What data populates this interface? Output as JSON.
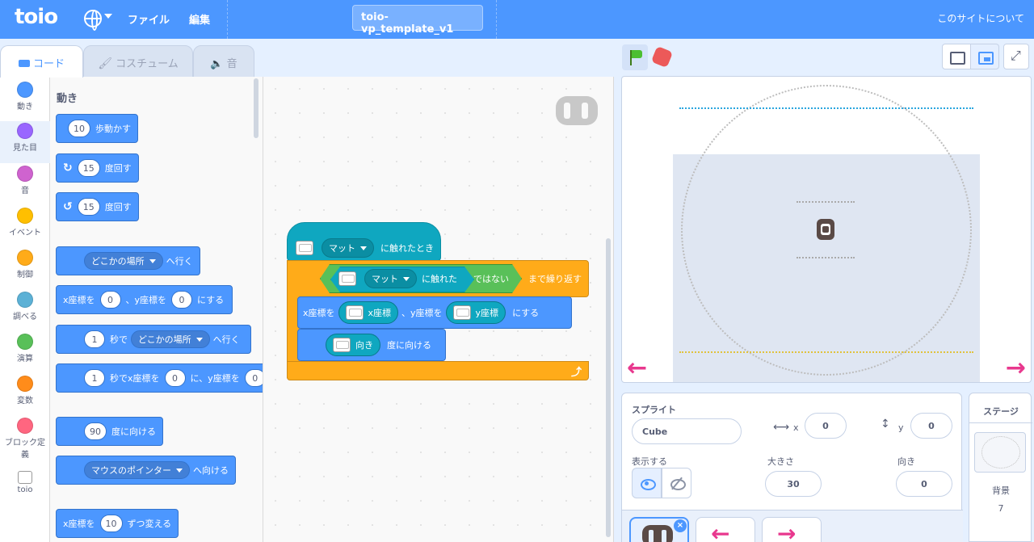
{
  "menubar": {
    "logo": "toio",
    "file_menu": "ファイル",
    "edit_menu": "編集",
    "project_title": "toio-vp_template_v1",
    "about": "このサイトについて"
  },
  "tabs": {
    "code": "コード",
    "costume": "コスチューム",
    "sound": "音"
  },
  "categories": [
    {
      "label": "動き",
      "color": "#4c97ff"
    },
    {
      "label": "見た目",
      "color": "#9966ff"
    },
    {
      "label": "音",
      "color": "#cf63cf"
    },
    {
      "label": "イベント",
      "color": "#ffbf00"
    },
    {
      "label": "制御",
      "color": "#ffab19"
    },
    {
      "label": "調べる",
      "color": "#5cb1d6"
    },
    {
      "label": "演算",
      "color": "#59c059"
    },
    {
      "label": "変数",
      "color": "#ff8c1a"
    },
    {
      "label": "ブロック定義",
      "color": "#ff6680"
    },
    {
      "label": "toio",
      "color": "#ffffff"
    }
  ],
  "palette": {
    "title": "動き",
    "move": {
      "value": "10",
      "label": "歩動かす"
    },
    "turn_right": {
      "value": "15",
      "label": "度回す"
    },
    "turn_left": {
      "value": "15",
      "label": "度回す"
    },
    "goto": {
      "option": "どこかの場所",
      "label": "へ行く"
    },
    "goto_xy": {
      "x_label": "x座標を",
      "x": "0",
      "y_label": "、y座標を",
      "y": "0",
      "suffix": "にする"
    },
    "glide": {
      "value": "1",
      "label1": "秒で",
      "option": "どこかの場所",
      "label2": "へ行く"
    },
    "glide_xy": {
      "value": "1",
      "label1": "秒でx座標を",
      "x": "0",
      "label2": "に、y座標を",
      "y": "0"
    },
    "point": {
      "value": "90",
      "label": "度に向ける"
    },
    "point_towards": {
      "option": "マウスのポインター",
      "label": "へ向ける"
    },
    "change_x": {
      "label": "x座標を",
      "value": "10",
      "suffix": "ずつ変える"
    }
  },
  "script": {
    "hat": {
      "option": "マット",
      "label": "に触れたとき"
    },
    "repeat_until": {
      "option": "マット",
      "touch_label": "に触れた",
      "not_label": "ではない",
      "label": "まで繰り返す"
    },
    "goto_xy": {
      "x_label": "x座標を",
      "x_reporter": "x座標",
      "y_label": "、y座標を",
      "y_reporter": "y座標",
      "suffix": "にする"
    },
    "point": {
      "reporter": "向き",
      "label": "度に向ける"
    }
  },
  "sprite_info": {
    "header": "スプライト",
    "name": "Cube",
    "x_label": "x",
    "x": "0",
    "y_label": "y",
    "y": "0",
    "show_label": "表示する",
    "size_label": "大きさ",
    "size": "30",
    "direction_label": "向き",
    "direction": "0"
  },
  "stage_panel": {
    "header": "ステージ",
    "backdrops_label": "背景",
    "backdrops_count": "7"
  },
  "icons": {
    "flag": "green-flag-icon",
    "stop": "stop-icon",
    "arrow_color": "#e8388e",
    "accent": "#4c97ff"
  }
}
